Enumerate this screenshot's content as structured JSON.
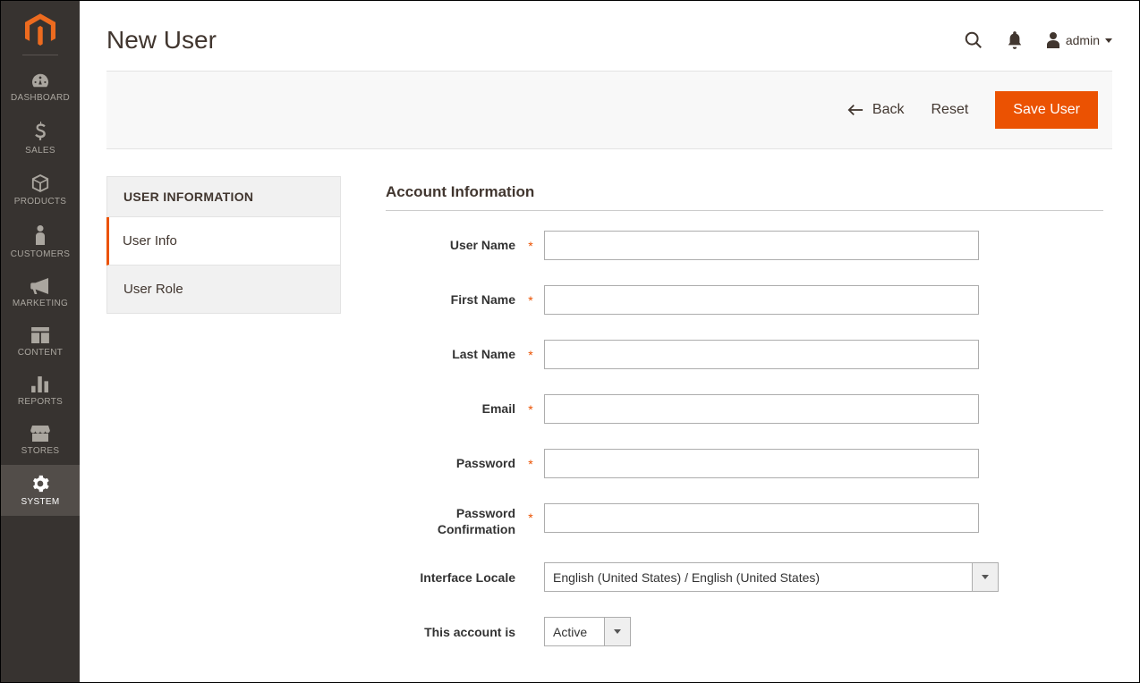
{
  "page": {
    "title": "New User"
  },
  "header": {
    "admin_label": "admin"
  },
  "sidebar": {
    "items": [
      {
        "label": "DASHBOARD"
      },
      {
        "label": "SALES"
      },
      {
        "label": "PRODUCTS"
      },
      {
        "label": "CUSTOMERS"
      },
      {
        "label": "MARKETING"
      },
      {
        "label": "CONTENT"
      },
      {
        "label": "REPORTS"
      },
      {
        "label": "STORES"
      },
      {
        "label": "SYSTEM"
      }
    ]
  },
  "actions": {
    "back": "Back",
    "reset": "Reset",
    "save": "Save User"
  },
  "tabs": {
    "header": "USER INFORMATION",
    "items": [
      {
        "label": "User Info"
      },
      {
        "label": "User Role"
      }
    ]
  },
  "form": {
    "section_title": "Account Information",
    "fields": {
      "username": {
        "label": "User Name",
        "value": ""
      },
      "firstname": {
        "label": "First Name",
        "value": ""
      },
      "lastname": {
        "label": "Last Name",
        "value": ""
      },
      "email": {
        "label": "Email",
        "value": ""
      },
      "password": {
        "label": "Password",
        "value": ""
      },
      "password_confirm": {
        "label": "Password Confirmation",
        "value": ""
      },
      "locale": {
        "label": "Interface Locale",
        "value": "English (United States) / English (United States)"
      },
      "account_is": {
        "label": "This account is",
        "value": "Active"
      }
    }
  }
}
